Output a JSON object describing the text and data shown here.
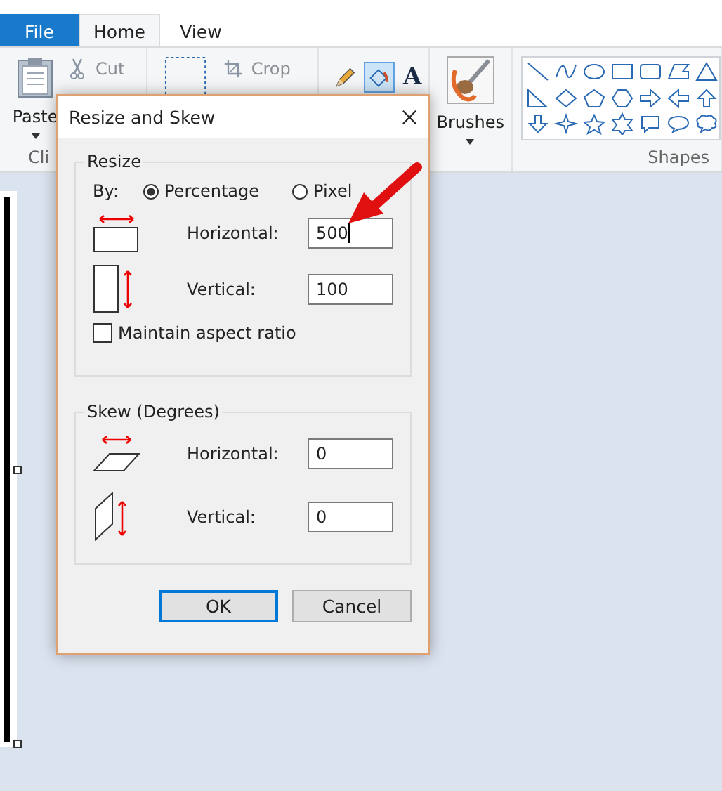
{
  "ribbon": {
    "tabs": [
      {
        "label": "File",
        "kind": "file",
        "selected": false
      },
      {
        "label": "Home",
        "kind": "tab",
        "selected": true
      },
      {
        "label": "View",
        "kind": "tab",
        "selected": false
      }
    ],
    "clipboard": {
      "paste": "Paste",
      "cut": "Cut",
      "group_label": "Cli"
    },
    "image": {
      "crop": "Crop"
    },
    "tools": [
      {
        "kind": "pencil",
        "selected": false
      },
      {
        "kind": "fill",
        "selected": true
      },
      {
        "kind": "text",
        "label": "A",
        "selected": false
      }
    ],
    "brushes": {
      "label": "Brushes"
    },
    "shapes": {
      "group_label": "Shapes"
    }
  },
  "dialog": {
    "title": "Resize and Skew",
    "resize": {
      "legend": "Resize",
      "by_label": "By:",
      "options": [
        {
          "label": "Percentage",
          "selected": true
        },
        {
          "label": "Pixel",
          "selected": false
        }
      ],
      "fields": [
        {
          "kind": "horizontal",
          "label": "Horizontal:",
          "value": "500",
          "focused": true
        },
        {
          "kind": "vertical",
          "label": "Vertical:",
          "value": "100",
          "focused": false
        }
      ],
      "maintain": {
        "label": "Maintain aspect ratio",
        "checked": false
      }
    },
    "skew": {
      "legend": "Skew (Degrees)",
      "fields": [
        {
          "kind": "horizontal",
          "label": "Horizontal:",
          "value": "0",
          "focused": false
        },
        {
          "kind": "vertical",
          "label": "Vertical:",
          "value": "0",
          "focused": false
        }
      ]
    },
    "buttons": [
      {
        "label": "OK",
        "default": true
      },
      {
        "label": "Cancel",
        "default": false
      }
    ]
  }
}
